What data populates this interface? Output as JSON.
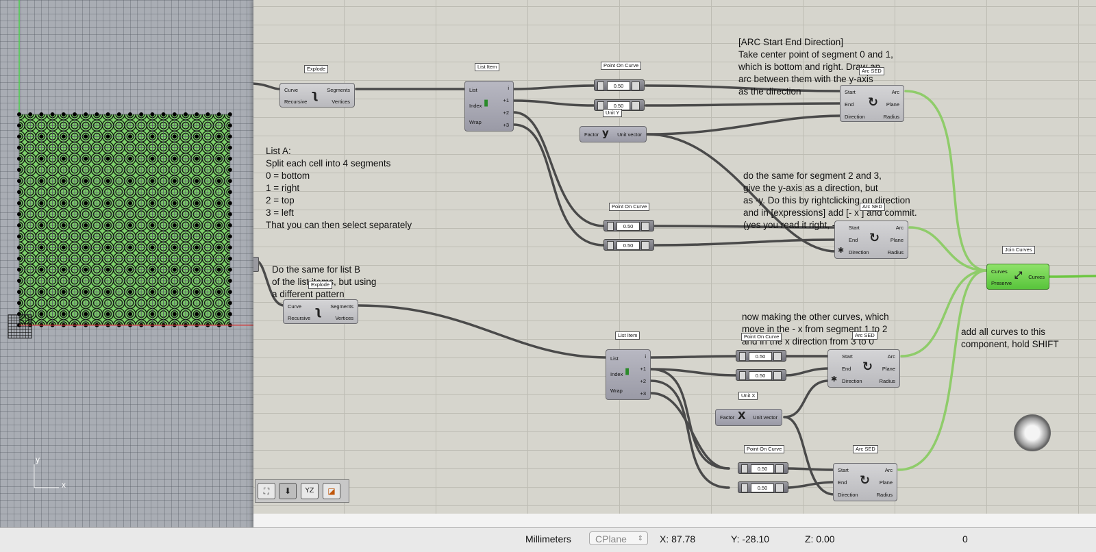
{
  "viewport": {
    "axis_y": "y",
    "axis_x": "x",
    "colors": {
      "background": "#a9adb4",
      "tile_green": "#7ccf6a",
      "curve": "#111111",
      "grid": "#555a62"
    }
  },
  "notes": {
    "arc_sed": [
      "[ARC Start End Direction]",
      "Take center point of segment 0 and 1,",
      "which is bottom and right. Draw an",
      "arc between them with the y-axis",
      "as the direction"
    ],
    "list_a": [
      "List A:",
      "Split each cell into 4 segments",
      "0 = bottom",
      "1 = right",
      "2 = top",
      "3 = left",
      "That you can then select separately"
    ],
    "same_23": [
      "do the same for segment 2 and 3,",
      "give the y-axis as a direction, but",
      "as -y. Do this by rightclicking on direction",
      "and in [expressions] add [- x ] and commit.",
      "(yes you read it right, - x )"
    ],
    "list_b": [
      "Do the same for list B",
      "of the list items, but using",
      "a different pattern"
    ],
    "other_curves": [
      "now making the other curves, which",
      "move in the - x from segment 1 to 2",
      "and in the x direction from 3 to 0"
    ],
    "join": [
      "add all curves to this",
      "component, hold SHIFT"
    ]
  },
  "components": {
    "explode1": {
      "title": "Explode",
      "in": [
        "Curve",
        "Recursive"
      ],
      "out": [
        "Segments",
        "Vertices"
      ]
    },
    "explode2": {
      "title": "Explode",
      "in": [
        "Curve",
        "Recursive"
      ],
      "out": [
        "Segments",
        "Vertices"
      ]
    },
    "listitem1": {
      "title": "List Item",
      "in": [
        "List",
        "Index",
        "Wrap"
      ],
      "out": [
        "i",
        "+1",
        "+2",
        "+3"
      ]
    },
    "listitem2": {
      "title": "List Item",
      "in": [
        "List",
        "Index",
        "Wrap"
      ],
      "out": [
        "i",
        "+1",
        "+2",
        "+3"
      ]
    },
    "poc1": {
      "title": "Point On Curve"
    },
    "poc2": {
      "title": "Point On Curve"
    },
    "poc3": {
      "title": "Point On Curve"
    },
    "poc4": {
      "title": "Point On Curve"
    },
    "unity": {
      "title": "Unit Y",
      "in": [
        "Factor"
      ],
      "out": [
        "Unit vector"
      ],
      "glyph": "y"
    },
    "unitx": {
      "title": "Unit X",
      "in": [
        "Factor"
      ],
      "out": [
        "Unit vector"
      ],
      "glyph": "X"
    },
    "arc1": {
      "title": "Arc SED",
      "in": [
        "Start",
        "End",
        "Direction"
      ],
      "out": [
        "Arc",
        "Plane",
        "Radius"
      ]
    },
    "arc2": {
      "title": "Arc SED",
      "in": [
        "Start",
        "End",
        "Direction"
      ],
      "out": [
        "Arc",
        "Plane",
        "Radius"
      ]
    },
    "arc3": {
      "title": "Arc SED",
      "in": [
        "Start",
        "End",
        "Direction"
      ],
      "out": [
        "Arc",
        "Plane",
        "Radius"
      ]
    },
    "arc4": {
      "title": "Arc SED",
      "in": [
        "Start",
        "End",
        "Direction"
      ],
      "out": [
        "Arc",
        "Plane",
        "Radius"
      ]
    },
    "join": {
      "title": "Join Curves",
      "in": [
        "Curves",
        "Preserve"
      ],
      "out": [
        "Curves"
      ]
    }
  },
  "sliders": {
    "s1": "0.50",
    "s2": "0.50",
    "s3": "0.50",
    "s4": "0.50",
    "s5": "0.50",
    "s6": "0.50",
    "s7": "0.50",
    "s8": "0.50"
  },
  "colors": {
    "canvas": "#d6d5cd",
    "wire": "#4a4a4a",
    "wire_selected": "#6cc640",
    "component": "#c4c4c8",
    "component_selected": "#6cd44a"
  },
  "toolbar": {
    "icons": [
      "box-edit-icon",
      "bake-icon",
      "xyz-preview-icon",
      "sketch-icon"
    ],
    "xyz_label": "YZ"
  },
  "statusbar": {
    "units": "Millimeters",
    "cplane": "CPlane",
    "x": "X: 87.78",
    "y": "Y: -28.10",
    "z": "Z: 0.00",
    "extra": "0"
  }
}
